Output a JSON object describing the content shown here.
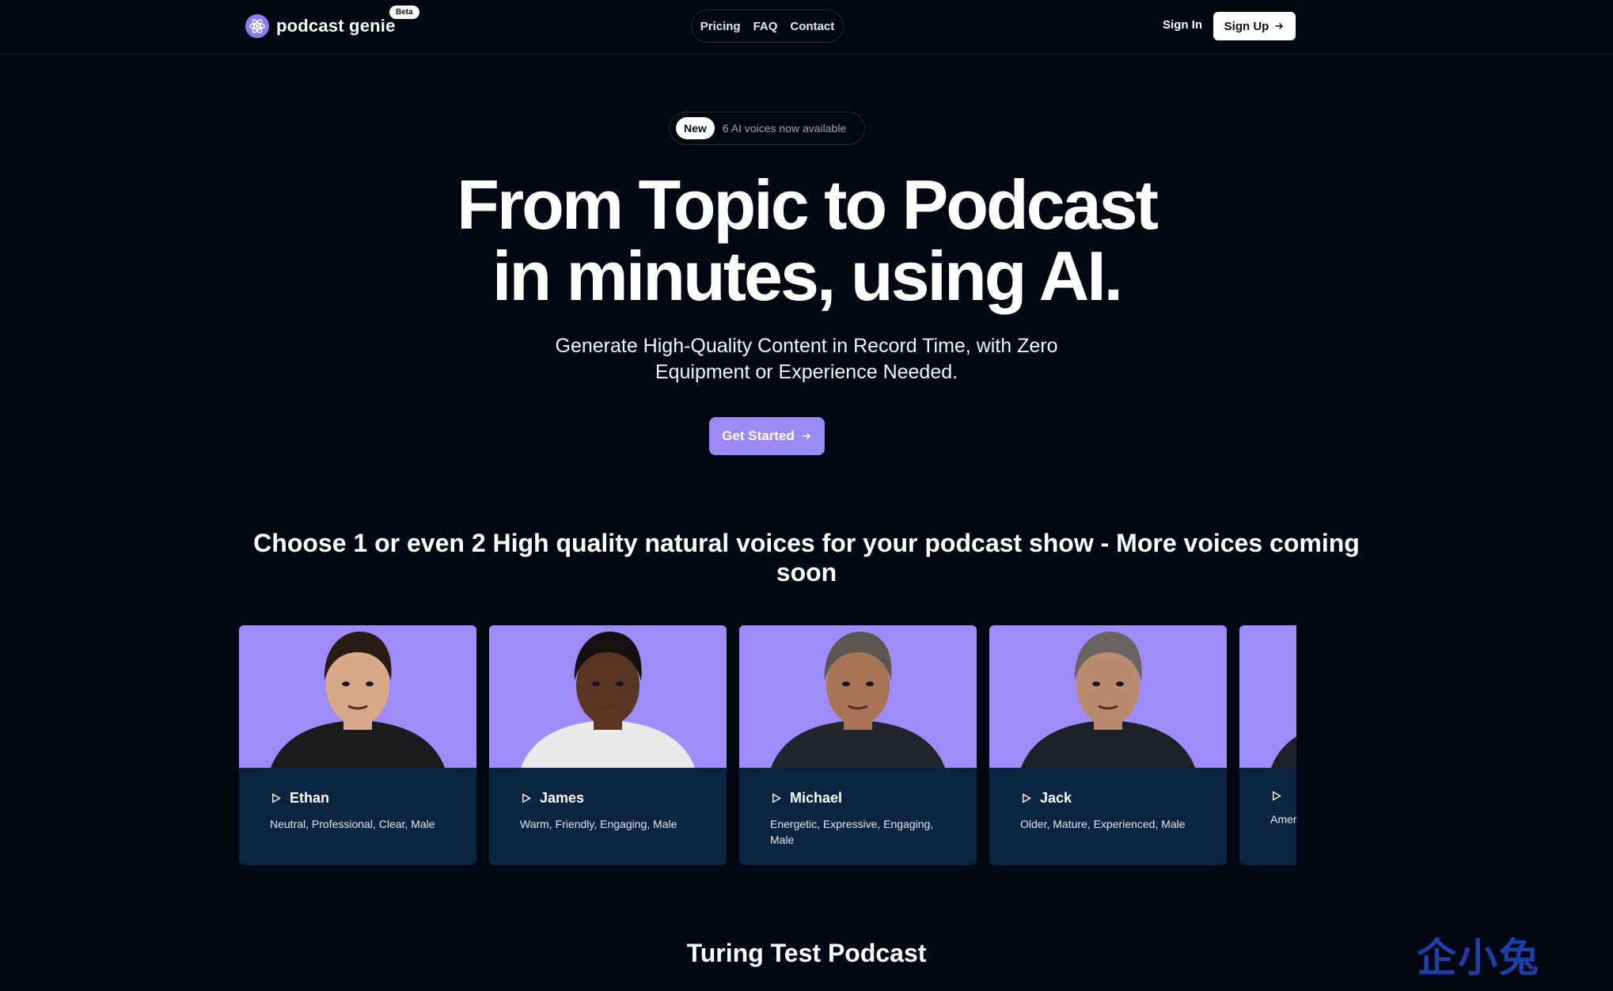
{
  "header": {
    "brand": "podcast genie",
    "beta": "Beta",
    "nav": [
      "Pricing",
      "FAQ",
      "Contact"
    ],
    "sign_in": "Sign In",
    "sign_up": "Sign Up"
  },
  "hero": {
    "badge": "New",
    "announcement": "6 AI voices now available",
    "title_line1": "From Topic to Podcast",
    "title_line2": "in minutes, using AI.",
    "subtitle_line1": "Generate High-Quality Content in Record Time, with Zero",
    "subtitle_line2": "Equipment or Experience Needed.",
    "cta": "Get Started"
  },
  "voices": {
    "heading_line1": "Choose 1 or even 2 High quality natural voices for your podcast show - More voices coming",
    "heading_line2": "soon",
    "cards": [
      {
        "name": "Ethan",
        "desc": "Neutral, Professional, Clear, Male",
        "skin": "#d9a88a",
        "hair": "#2a1c14",
        "shirt": "#1b1b1e"
      },
      {
        "name": "James",
        "desc": "Warm, Friendly, Engaging, Male",
        "skin": "#5a3524",
        "hair": "#141010",
        "shirt": "#e9e9e9"
      },
      {
        "name": "Michael",
        "desc": "Energetic, Expressive, Engaging, Male",
        "skin": "#a87558",
        "hair": "#5a5650",
        "shirt": "#22252c"
      },
      {
        "name": "Jack",
        "desc": "Older, Mature, Experienced, Male",
        "skin": "#b98a70",
        "hair": "#6a6460",
        "shirt": "#1d2027"
      },
      {
        "name": "",
        "desc": "Amer Male",
        "skin": "#b98a70",
        "hair": "#444",
        "shirt": "#1d2027"
      }
    ]
  },
  "section": {
    "title": "Turing Test Podcast"
  },
  "colors": {
    "background": "#030712",
    "accent": "#9c89f5",
    "card": "#0b2441",
    "photo_bg": "#9f8cf8"
  },
  "icons": [
    "atom-logo-icon",
    "arrow-right-icon",
    "play-icon"
  ],
  "watermark": "企小兔"
}
